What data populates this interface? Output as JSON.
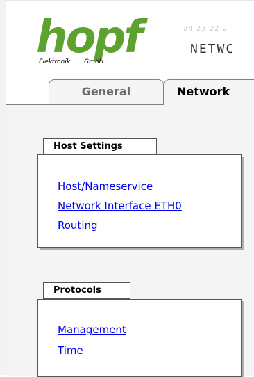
{
  "header": {
    "logo": {
      "name": "hopf",
      "sub_left": "Elektronik",
      "sub_right": "GmbH",
      "color": "#5da12f"
    },
    "digits": "24 23 22 2",
    "section_title": "NETWC"
  },
  "tabs": [
    {
      "label": "General",
      "active": false
    },
    {
      "label": "Network",
      "active": true
    }
  ],
  "groups": {
    "host_settings": {
      "label": "Host Settings",
      "links": [
        "Host/Nameservice",
        "Network Interface ETH0",
        "Routing"
      ]
    },
    "protocols": {
      "label": "Protocols",
      "links": [
        "Management",
        "Time"
      ]
    }
  },
  "colors": {
    "link": "#0000ee",
    "panel_bg": "#f4f4f4",
    "tab_inactive_text": "#6b6b6b"
  }
}
